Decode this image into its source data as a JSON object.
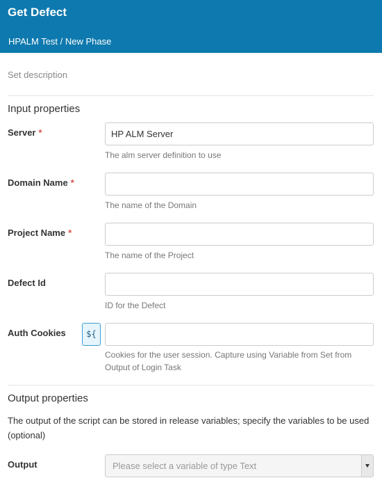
{
  "header": {
    "title": "Get Defect",
    "breadcrumb": "HPALM Test / New Phase"
  },
  "description_placeholder": "Set description",
  "input_section": {
    "title": "Input properties",
    "fields": [
      {
        "label": "Server",
        "required": "*",
        "value": "HP ALM Server",
        "help": "The alm server definition to use"
      },
      {
        "label": "Domain Name",
        "required": "*",
        "value": "",
        "help": "The name of the Domain"
      },
      {
        "label": "Project Name",
        "required": "*",
        "value": "",
        "help": "The name of the Project"
      },
      {
        "label": "Defect Id",
        "value": "",
        "help": "ID for the Defect"
      },
      {
        "label": "Auth Cookies",
        "value": "",
        "variable_toggle": "${",
        "help": "Cookies for the user session. Capture using Variable from Set from Output of Login Task"
      }
    ]
  },
  "output_section": {
    "title": "Output properties",
    "description": "The output of the script can be stored in release variables; specify the variables to be used (optional)",
    "fields": [
      {
        "label": "Output",
        "placeholder": "Please select a variable of type Text"
      }
    ]
  },
  "colors": {
    "header_bg": "#0e79ae",
    "required": "#d9534f",
    "variable_button_border": "#3a9fd1"
  }
}
